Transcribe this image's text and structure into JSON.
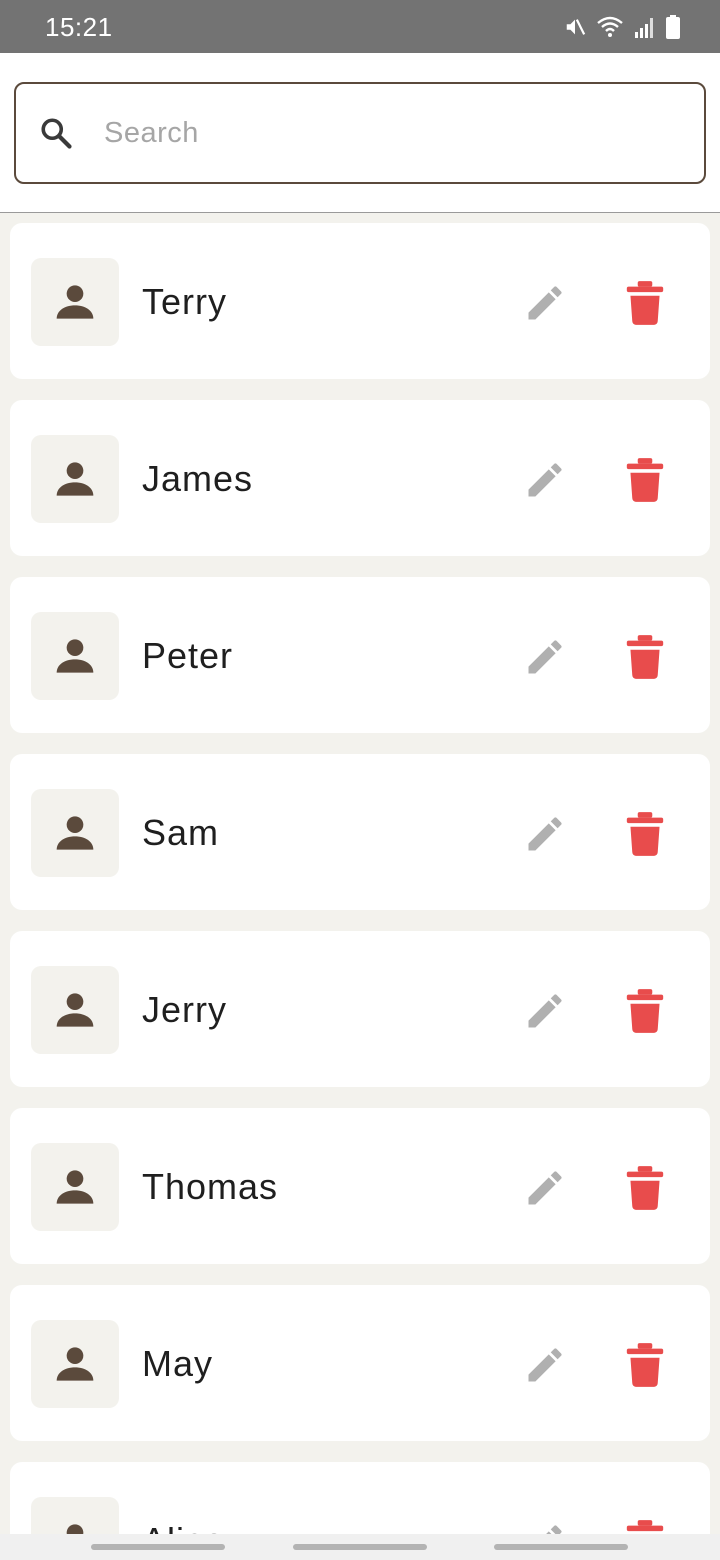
{
  "status_bar": {
    "time": "15:21",
    "icons": [
      "mute-icon",
      "wifi-icon",
      "signal-icon",
      "battery-icon"
    ]
  },
  "search": {
    "placeholder": "Search",
    "value": ""
  },
  "contacts": [
    {
      "name": "Terry"
    },
    {
      "name": "James"
    },
    {
      "name": "Peter"
    },
    {
      "name": "Sam"
    },
    {
      "name": "Jerry"
    },
    {
      "name": "Thomas"
    },
    {
      "name": "May"
    },
    {
      "name": "Alice"
    }
  ],
  "colors": {
    "background": "#f3f2ed",
    "accent_brown": "#5b4a3c",
    "delete_red": "#e84c4c",
    "edit_gray": "#b0b0b0",
    "status_bar": "#737373"
  }
}
